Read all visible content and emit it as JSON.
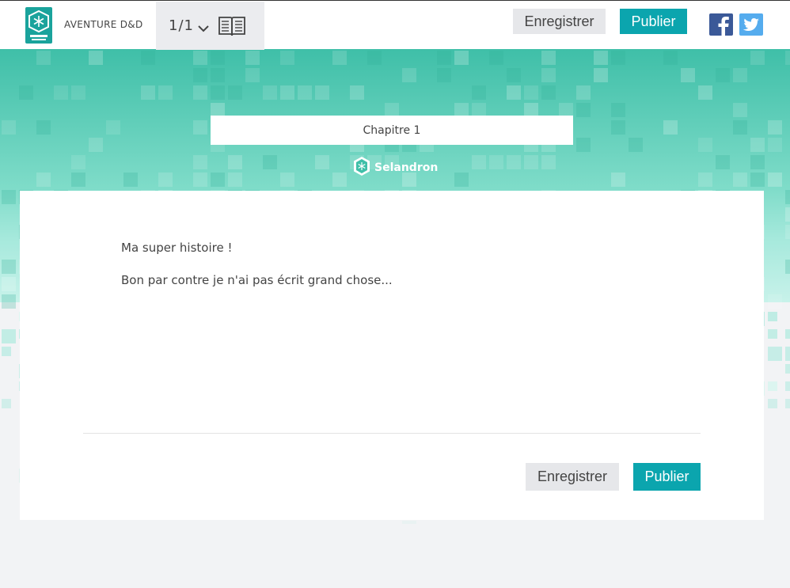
{
  "brand": {
    "name": "AVENTURE D&D",
    "logo_icon": "snowflake-badge-icon",
    "accent_color": "#1aa39c"
  },
  "chapter_nav": {
    "count": "1/1",
    "dropdown_icon": "chevron-down-icon",
    "read_icon": "open-book-icon"
  },
  "toolbar": {
    "save_label": "Enregistrer",
    "publish_label": "Publier"
  },
  "social": {
    "facebook_icon": "facebook-icon",
    "twitter_icon": "twitter-icon",
    "facebook_color": "#3b5998",
    "twitter_color": "#55acee"
  },
  "chapter": {
    "title": "Chapitre 1",
    "author": "Selandron"
  },
  "editor": {
    "paragraphs": [
      "Ma super histoire !",
      "Bon par contre je n'ai pas écrit grand chose..."
    ]
  },
  "footer_actions": {
    "save_label": "Enregistrer",
    "publish_label": "Publier"
  },
  "colors": {
    "primary": "#0ba5ae",
    "hero_top": "#3fbfa8",
    "hero_bottom": "#9fe6d9",
    "page_bg": "#f2f3f5"
  }
}
